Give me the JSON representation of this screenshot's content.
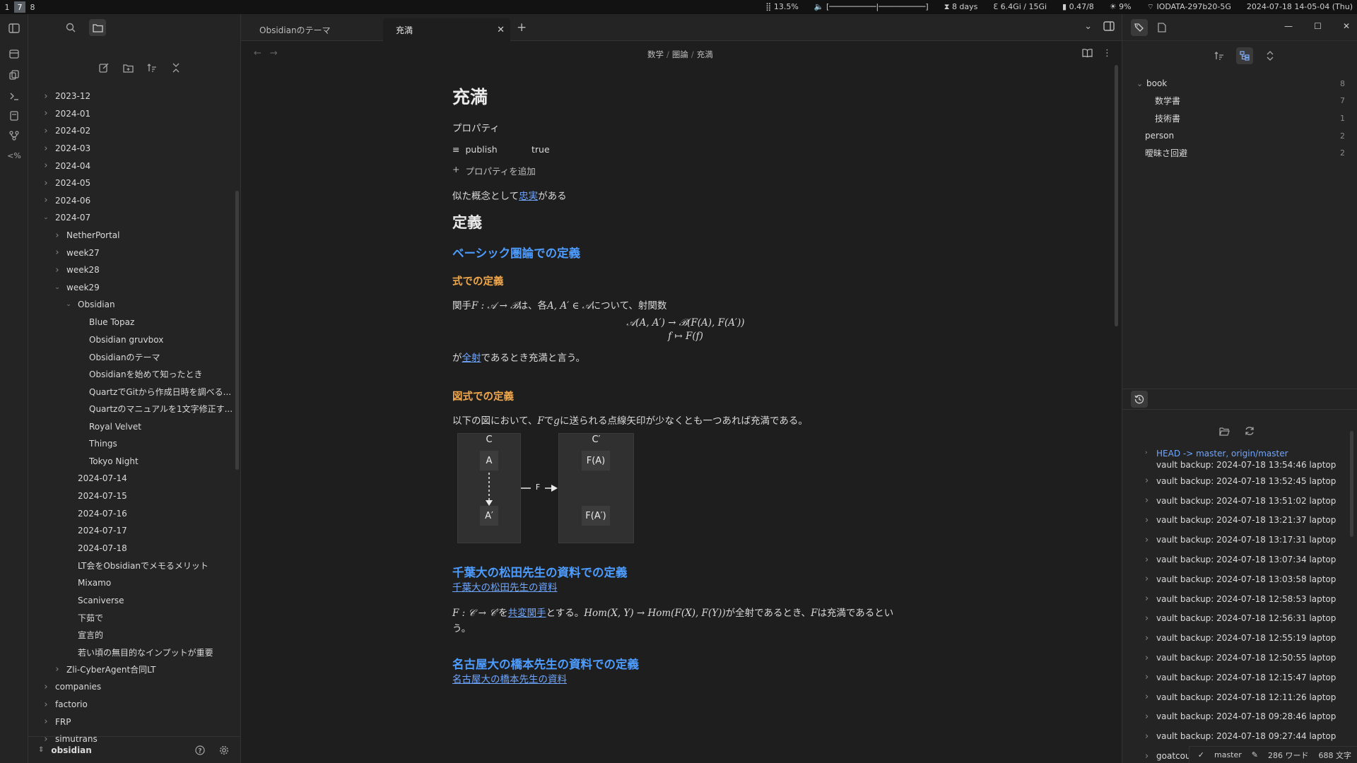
{
  "sysbar": {
    "workspaces": [
      "1",
      "7",
      "8"
    ],
    "active_workspace": "7",
    "cpu": "13.5%",
    "uptime": "8 days",
    "memory": "6.4Gi / 15Gi",
    "load": "0.47/8",
    "brightness": "9%",
    "wifi": "IODATA-297b20-5G",
    "clock": "2024-07-18 14-05-04 (Thu)"
  },
  "left": {
    "tree": [
      {
        "label": "2023-12",
        "depth": 0,
        "chev": "right"
      },
      {
        "label": "2024-01",
        "depth": 0,
        "chev": "right"
      },
      {
        "label": "2024-02",
        "depth": 0,
        "chev": "right"
      },
      {
        "label": "2024-03",
        "depth": 0,
        "chev": "right"
      },
      {
        "label": "2024-04",
        "depth": 0,
        "chev": "right"
      },
      {
        "label": "2024-05",
        "depth": 0,
        "chev": "right"
      },
      {
        "label": "2024-06",
        "depth": 0,
        "chev": "right"
      },
      {
        "label": "2024-07",
        "depth": 0,
        "chev": "down"
      },
      {
        "label": "NetherPortal",
        "depth": 1,
        "chev": "right"
      },
      {
        "label": "week27",
        "depth": 1,
        "chev": "right"
      },
      {
        "label": "week28",
        "depth": 1,
        "chev": "right"
      },
      {
        "label": "week29",
        "depth": 1,
        "chev": "down"
      },
      {
        "label": "Obsidian",
        "depth": 2,
        "chev": "down"
      },
      {
        "label": "Blue Topaz",
        "depth": 3,
        "chev": ""
      },
      {
        "label": "Obsidian gruvbox",
        "depth": 3,
        "chev": ""
      },
      {
        "label": "Obsidianのテーマ",
        "depth": 3,
        "chev": ""
      },
      {
        "label": "Obsidianを始めて知ったとき",
        "depth": 3,
        "chev": ""
      },
      {
        "label": "QuartzでGitから作成日時を調べる...",
        "depth": 3,
        "chev": ""
      },
      {
        "label": "Quartzのマニュアルを1文字修正す...",
        "depth": 3,
        "chev": ""
      },
      {
        "label": "Royal Velvet",
        "depth": 3,
        "chev": ""
      },
      {
        "label": "Things",
        "depth": 3,
        "chev": ""
      },
      {
        "label": "Tokyo Night",
        "depth": 3,
        "chev": ""
      },
      {
        "label": "2024-07-14",
        "depth": 2,
        "chev": ""
      },
      {
        "label": "2024-07-15",
        "depth": 2,
        "chev": ""
      },
      {
        "label": "2024-07-16",
        "depth": 2,
        "chev": ""
      },
      {
        "label": "2024-07-17",
        "depth": 2,
        "chev": ""
      },
      {
        "label": "2024-07-18",
        "depth": 2,
        "chev": ""
      },
      {
        "label": "LT会をObsidianでメモるメリット",
        "depth": 2,
        "chev": ""
      },
      {
        "label": "Mixamo",
        "depth": 2,
        "chev": ""
      },
      {
        "label": "Scaniverse",
        "depth": 2,
        "chev": ""
      },
      {
        "label": "下茹で",
        "depth": 2,
        "chev": ""
      },
      {
        "label": "宣言的",
        "depth": 2,
        "chev": ""
      },
      {
        "label": "若い頃の無目的なインプットが重要",
        "depth": 2,
        "chev": ""
      },
      {
        "label": "Zli-CyberAgent合同LT",
        "depth": 1,
        "chev": "right"
      },
      {
        "label": "companies",
        "depth": 0,
        "chev": "right"
      },
      {
        "label": "factorio",
        "depth": 0,
        "chev": "right"
      },
      {
        "label": "FRP",
        "depth": 0,
        "chev": "right"
      },
      {
        "label": "simutrans",
        "depth": 0,
        "chev": "right"
      }
    ],
    "vault_name": "obsidian"
  },
  "tabs": [
    {
      "label": "Obsidianのテーマ",
      "active": false
    },
    {
      "label": "充満",
      "active": true
    }
  ],
  "breadcrumb": [
    "数学",
    "圏論",
    "充満"
  ],
  "note": {
    "title": "充満",
    "properties_heading": "プロパティ",
    "prop_key": "publish",
    "prop_value": "true",
    "add_property": "プロパティを追加",
    "intro_pre": "似た概念として",
    "intro_link": "忠実",
    "intro_post": "がある",
    "h_definition": "定義",
    "h_basic": "ベーシック圏論での定義",
    "h_formula": "式での定義",
    "formula_text_1": "関手",
    "formula_math_1": "F : 𝒜 → ℬ",
    "formula_text_2": "は、各",
    "formula_math_2": "A, A′ ∈ 𝒜",
    "formula_text_3": "について、射関数",
    "math_line1": "𝒜(A, A′) → ℬ(F(A), F(A′))",
    "math_line2": "f ↦ F(f)",
    "surj_pre": "が",
    "surj_link": "全射",
    "surj_post": "であるとき充満と言う。",
    "h_diagram": "図式での定義",
    "diagram_text_1": "以下の図において、",
    "diagram_math_1": "F",
    "diagram_text_2": "で",
    "diagram_math_2": "g",
    "diagram_text_3": "に送られる点線矢印が少なくとも一つあれば充満である。",
    "diagram": {
      "C": "C",
      "Cp": "C′",
      "A": "A",
      "Ap": "A′",
      "FA": "F(A)",
      "FAp": "F(A′)",
      "F": "F"
    },
    "h_chiba": "千葉大の松田先生の資料での定義",
    "chiba_link": "千葉大の松田先生の資料",
    "chiba_math_1": "F : 𝒞 → 𝒞′",
    "chiba_text_1": "を",
    "chiba_link2": "共変関手",
    "chiba_text_2": "とする。",
    "chiba_math_2": "Hom(X, Y) → Hom(F(X), F(Y))",
    "chiba_text_3": "が全射であるとき、",
    "chiba_math_3": "F",
    "chiba_text_4": "は充満であるという。",
    "h_nagoya": "名古屋大の橋本先生の資料での定義",
    "nagoya_link": "名古屋大の橋本先生の資料"
  },
  "tags": [
    {
      "label": "book",
      "count": "8",
      "depth": 0,
      "chev": "down"
    },
    {
      "label": "数学書",
      "count": "7",
      "depth": 1,
      "chev": ""
    },
    {
      "label": "技術書",
      "count": "1",
      "depth": 1,
      "chev": ""
    },
    {
      "label": "person",
      "count": "2",
      "depth": 0,
      "chev": ""
    },
    {
      "label": "曖昧さ回避",
      "count": "2",
      "depth": 0,
      "chev": ""
    }
  ],
  "git": {
    "head_ref": "HEAD -> master, origin/master",
    "head_msg": "vault backup: 2024-07-18 13:54:46 laptop",
    "commits": [
      "vault backup: 2024-07-18 13:52:45 laptop",
      "vault backup: 2024-07-18 13:51:02 laptop",
      "vault backup: 2024-07-18 13:21:37 laptop",
      "vault backup: 2024-07-18 13:17:31 laptop",
      "vault backup: 2024-07-18 13:07:34 laptop",
      "vault backup: 2024-07-18 13:03:58 laptop",
      "vault backup: 2024-07-18 12:58:53 laptop",
      "vault backup: 2024-07-18 12:56:31 laptop",
      "vault backup: 2024-07-18 12:55:19 laptop",
      "vault backup: 2024-07-18 12:50:55 laptop",
      "vault backup: 2024-07-18 12:15:47 laptop",
      "vault backup: 2024-07-18 12:11:26 laptop",
      "vault backup: 2024-07-18 09:28:46 laptop",
      "vault backup: 2024-07-18 09:27:44 laptop",
      "goatcounter"
    ]
  },
  "status": {
    "branch": "master",
    "words": "286 ワード",
    "chars": "688 文字"
  }
}
